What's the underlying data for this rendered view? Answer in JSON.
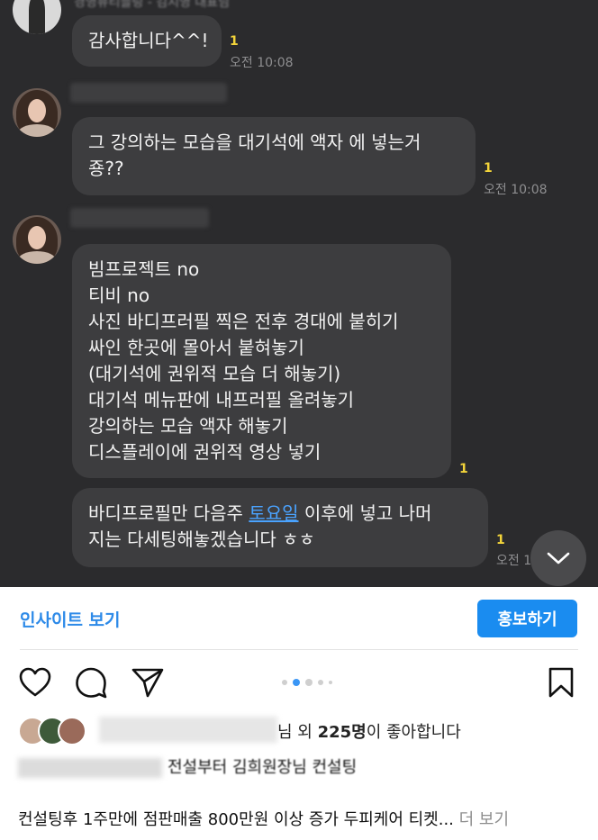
{
  "chat": {
    "top_sender_name": "경영뷰티블링 - 김지영 대표님",
    "messages": [
      {
        "lines": [
          "감사합니다^^!"
        ],
        "unread": "1",
        "time": "오전 10:08"
      },
      {
        "lines": [
          "그 강의하는 모습을 대기석에 액자 에 넣는거",
          "죵??"
        ],
        "unread": "1",
        "time": "오전 10:08"
      },
      {
        "lines": [
          "빔프로젝트 no",
          "티비 no",
          "사진 바디프러필 찍은 전후 경대에 붙히기",
          "싸인 한곳에 몰아서 붙혀놓기",
          "(대기석에 권위적 모습 더 해놓기)",
          "대기석 메뉴판에 내프러필 올려놓기",
          "강의하는 모습 액자 해놓기",
          "디스플레이에 권위적 영상 넣기"
        ],
        "unread": "1"
      },
      {
        "line1_pre": "바디프로필만 다음주 ",
        "line1_link": "토요일",
        "line1_post": " 이후에 넣고 나머",
        "line2": "지는 다세팅해놓겠습니다 ㅎㅎ",
        "unread": "1",
        "time": "오전 1"
      }
    ],
    "scroll_down_icon": "chevron-down-icon"
  },
  "post": {
    "insight_label": "인사이트 보기",
    "promote_label": "홍보하기",
    "icons": [
      "heart-icon",
      "comment-icon",
      "share-icon",
      "bookmark-icon"
    ],
    "carousel": {
      "count": 5,
      "active_index": 1
    },
    "likes_suffix": "님 외 ",
    "likes_count": "225명",
    "likes_tail": "이 좋아합니다",
    "caption_title": "전설부터 김희원장님 컨설팅",
    "description": "컨설팅후 1주만에 점판매출 800만원 이상 증가 두피케어 티켓...",
    "more_label": "더 보기"
  },
  "colors": {
    "chat_bg": "#2b2b2d",
    "bubble": "#3d3d3f",
    "unread": "#f3d43a",
    "accent": "#1a8cf0",
    "link": "#4aa3ff"
  }
}
